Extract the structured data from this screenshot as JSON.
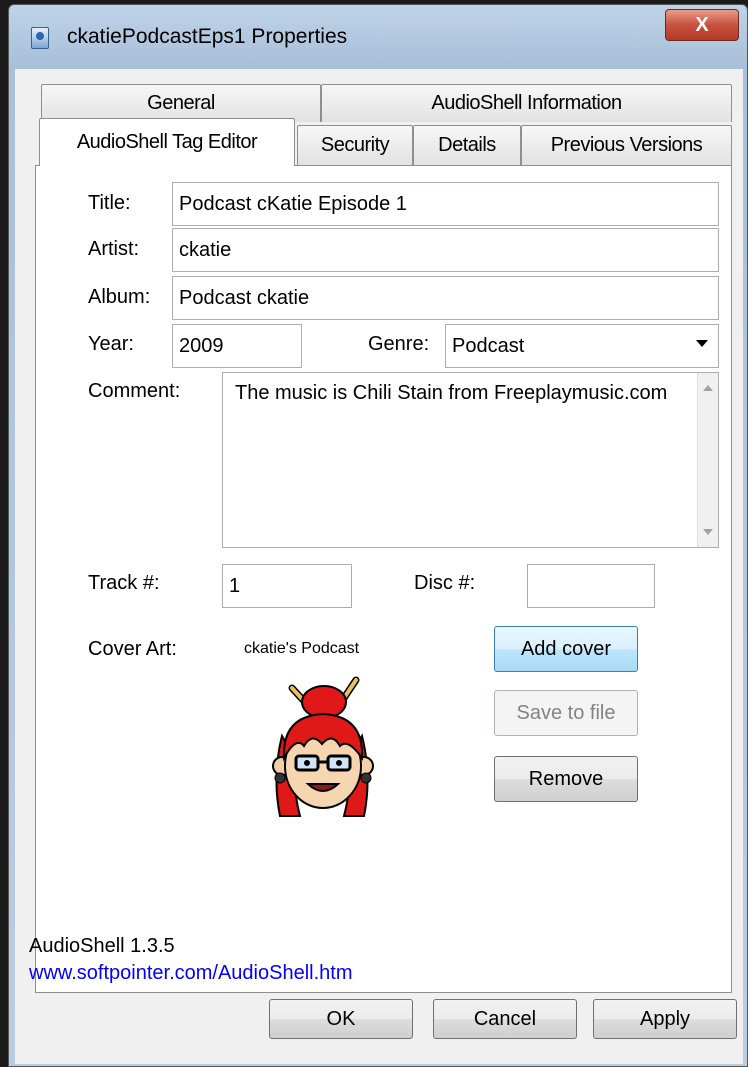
{
  "window": {
    "title": "ckatiePodcastEps1 Properties",
    "close_glyph": "X"
  },
  "tabs": {
    "row1": [
      "General",
      "AudioShell Information"
    ],
    "row2": [
      "AudioShell Tag Editor",
      "Security",
      "Details",
      "Previous Versions"
    ],
    "active": "AudioShell Tag Editor"
  },
  "form": {
    "title_label": "Title:",
    "title_value": "Podcast cKatie Episode 1",
    "artist_label": "Artist:",
    "artist_value": "ckatie",
    "album_label": "Album:",
    "album_value": "Podcast ckatie",
    "year_label": "Year:",
    "year_value": "2009",
    "genre_label": "Genre:",
    "genre_value": "Podcast",
    "comment_label": "Comment:",
    "comment_value": "The music is Chili Stain from Freeplaymusic.com",
    "track_label": "Track #:",
    "track_value": "1",
    "disc_label": "Disc #:",
    "disc_value": "",
    "cover_label": "Cover Art:",
    "cover_caption": "ckatie's Podcast",
    "add_cover": "Add cover",
    "save_to_file": "Save to file",
    "remove": "Remove"
  },
  "footer": {
    "version": "AudioShell 1.3.5",
    "link": "www.softpointer.com/AudioShell.htm"
  },
  "buttons": {
    "ok": "OK",
    "cancel": "Cancel",
    "apply": "Apply"
  },
  "colors": {
    "link": "#0000ff",
    "close_button": "#c9523e",
    "focus_border": "#3c7fb1"
  }
}
